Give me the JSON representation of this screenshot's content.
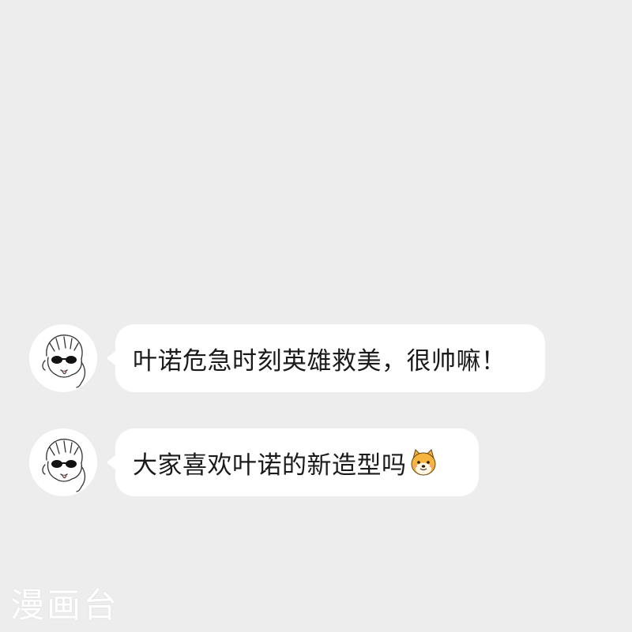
{
  "chat": {
    "messages": [
      {
        "text": "叶诺危急时刻英雄救美，很帅嘛！",
        "avatar_icon": "sketch-avatar-sunglasses-icon"
      },
      {
        "text": "大家喜欢叶诺的新造型吗",
        "emoji_icon": "shiba-dog-emoji-icon",
        "avatar_icon": "sketch-avatar-sunglasses-icon"
      }
    ]
  },
  "watermark": {
    "text": "漫画台"
  },
  "colors": {
    "background": "#ededed",
    "bubble": "#ffffff",
    "text": "#1a1a1a"
  }
}
